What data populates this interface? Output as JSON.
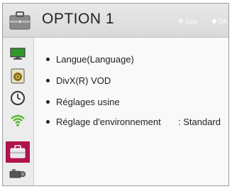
{
  "header": {
    "title": "OPTION 1",
    "hint_move": "Dép.",
    "hint_ok": "OK",
    "icon": "option-briefcase-icon"
  },
  "sidebar": {
    "items": [
      {
        "icon": "picture-monitor-icon",
        "active": false
      },
      {
        "icon": "audio-speaker-icon",
        "active": false
      },
      {
        "icon": "clock-icon",
        "active": false
      },
      {
        "icon": "network-wifi-icon",
        "active": false
      },
      {
        "icon": "option-briefcase-icon",
        "active": true
      },
      {
        "icon": "camera-projector-icon",
        "active": false
      }
    ]
  },
  "menu": {
    "items": [
      {
        "label": "Langue(Language)",
        "value": ""
      },
      {
        "label": "DivX(R) VOD",
        "value": ""
      },
      {
        "label": "Réglages usine",
        "value": ""
      },
      {
        "label": "Réglage d'environnement",
        "value": ": Standard"
      }
    ]
  },
  "colors": {
    "active": "#b0134d",
    "header_bg": "#e0e0e0",
    "monitor": "#2f9a2b",
    "wifi": "#55b82e"
  }
}
